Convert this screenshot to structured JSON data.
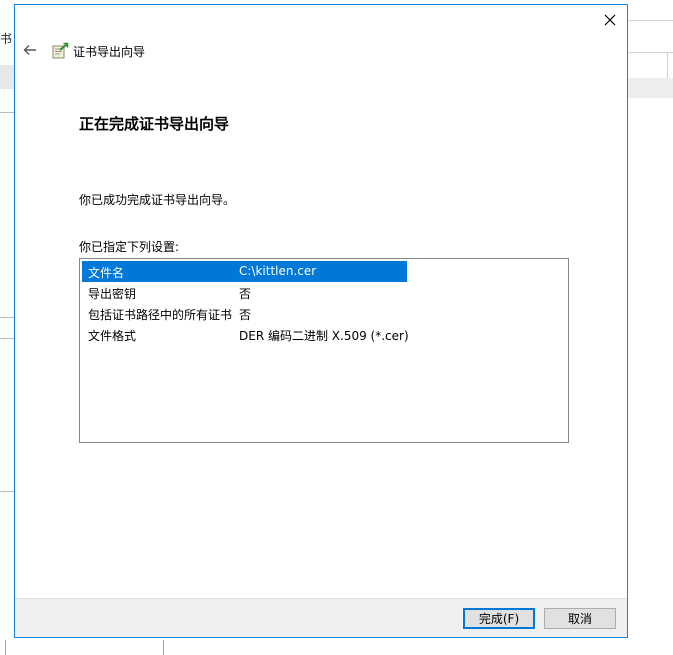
{
  "background": {
    "left_fragment_text": "书"
  },
  "wizard": {
    "title": "证书导出向导",
    "heading": "正在完成证书导出向导",
    "message": "你已成功完成证书导出向导。",
    "settings_label": "你已指定下列设置:",
    "settings": [
      {
        "name": "文件名",
        "value": "C:\\kittlen.cer",
        "selected": true
      },
      {
        "name": "导出密钥",
        "value": "否",
        "selected": false
      },
      {
        "name": "包括证书路径中的所有证书",
        "value": "否",
        "selected": false
      },
      {
        "name": "文件格式",
        "value": "DER 编码二进制 X.509 (*.cer)",
        "selected": false
      }
    ],
    "finish_label": "完成(F)",
    "cancel_label": "取消",
    "icons": {
      "close": "close-icon",
      "back": "back-arrow-icon",
      "wizard": "certificate-wizard-icon"
    }
  },
  "colors": {
    "accent": "#0078d7",
    "border": "#1883d7",
    "footer_bg": "#f0f0f0"
  }
}
